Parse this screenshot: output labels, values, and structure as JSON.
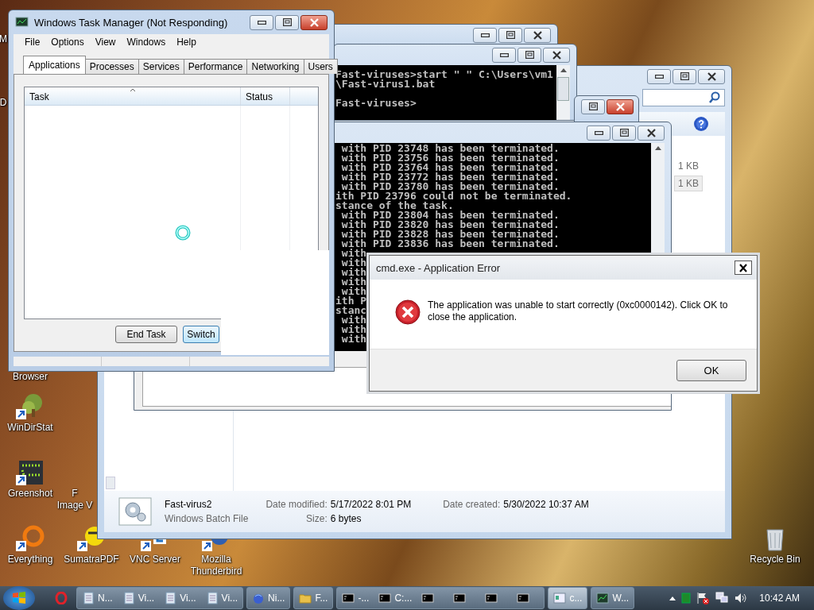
{
  "desktop": {
    "icons": [
      {
        "lines": [
          "M"
        ],
        "kind": "cut"
      },
      {
        "lines": [
          "D"
        ],
        "kind": "cut"
      },
      {
        "lines": [
          "Browser"
        ],
        "kind": "cut"
      },
      {
        "lines": [
          "WinDirStat"
        ],
        "kind": "tree"
      },
      {
        "lines": [
          "Greenshot"
        ],
        "kind": "dots"
      },
      {
        "lines": [
          "F",
          "Image V"
        ],
        "kind": "cut"
      },
      {
        "lines": [
          "Everything"
        ],
        "kind": "ring"
      },
      {
        "lines": [
          "SumatraPDF"
        ],
        "kind": "pdf"
      },
      {
        "lines": [
          "VNC Server"
        ],
        "kind": "vnc"
      },
      {
        "lines": [
          "Mozilla",
          "Thunderbird"
        ],
        "kind": "bird"
      },
      {
        "lines": [
          "Recycle Bin"
        ],
        "kind": "bin"
      }
    ]
  },
  "explorer": {
    "sizes": [
      {
        "text": "1 KB",
        "selected": false
      },
      {
        "text": "1 KB",
        "selected": true
      }
    ],
    "details": {
      "name": "Fast-virus2",
      "type": "Windows Batch File",
      "fields": [
        {
          "label": "Date modified:",
          "value": "5/17/2022 8:01 PM"
        },
        {
          "label": "Size:",
          "value": "6 bytes"
        },
        {
          "label": "Date created:",
          "value": "5/30/2022 10:37 AM"
        }
      ]
    }
  },
  "cmd_top": {
    "blocks": [
      [
        "Fast-viruses>start \" \" C:\\Users\\vm1",
        "\\Fast-virus1.bat"
      ],
      [
        "Fast-viruses>"
      ]
    ]
  },
  "cmd_main": {
    "lines": [
      " with PID 23748 has been terminated.",
      " with PID 23756 has been terminated.",
      " with PID 23764 has been terminated.",
      " with PID 23772 has been terminated.",
      " with PID 23780 has been terminated.",
      "ith PID 23796 could not be terminated.",
      "stance of the task.",
      " with PID 23804 has been terminated.",
      " with PID 23820 has been terminated.",
      " with PID 23828 has been terminated.",
      " with PID 23836 has been terminated.",
      " with",
      " with",
      " with",
      " with",
      " with",
      "ith P",
      "stanc",
      " with",
      " with",
      " with"
    ]
  },
  "task_manager": {
    "title": "Windows Task Manager (Not Responding)",
    "menu": [
      "File",
      "Options",
      "View",
      "Windows",
      "Help"
    ],
    "tabs": [
      {
        "label": "Applications",
        "selected": true
      },
      {
        "label": "Processes",
        "selected": false
      },
      {
        "label": "Services",
        "selected": false
      },
      {
        "label": "Performance",
        "selected": false
      },
      {
        "label": "Networking",
        "selected": false
      },
      {
        "label": "Users",
        "selected": false
      }
    ],
    "columns": [
      "Task",
      "Status"
    ],
    "buttons": [
      "End Task",
      "Switch"
    ]
  },
  "error_dialog": {
    "title": "cmd.exe - Application Error",
    "message": "The application was unable to start correctly (0xc0000142). Click OK to close the application.",
    "button": "OK"
  },
  "taskbar": {
    "groups": [
      {
        "selected": false,
        "items": [
          {
            "kind": "opera"
          }
        ]
      },
      {
        "selected": false,
        "items": [
          {
            "kind": "note",
            "label": "N..."
          },
          {
            "kind": "note",
            "label": "Vi..."
          },
          {
            "kind": "note",
            "label": "Vi..."
          },
          {
            "kind": "note",
            "label": "Vi..."
          }
        ]
      },
      {
        "selected": false,
        "items": [
          {
            "kind": "globe",
            "label": "Ni..."
          }
        ]
      },
      {
        "selected": false,
        "items": [
          {
            "kind": "folder",
            "label": "F..."
          }
        ]
      },
      {
        "selected": false,
        "items": [
          {
            "kind": "cmd",
            "label": "-..."
          },
          {
            "kind": "cmd",
            "label": "C:..."
          },
          {
            "kind": "cmd"
          },
          {
            "kind": "cmd"
          },
          {
            "kind": "cmd"
          },
          {
            "kind": "cmd"
          }
        ]
      },
      {
        "selected": true,
        "items": [
          {
            "kind": "app",
            "label": "c..."
          }
        ]
      },
      {
        "selected": false,
        "items": [
          {
            "kind": "taskmgr",
            "label": "W..."
          }
        ]
      }
    ],
    "clock": "10:42 AM"
  }
}
